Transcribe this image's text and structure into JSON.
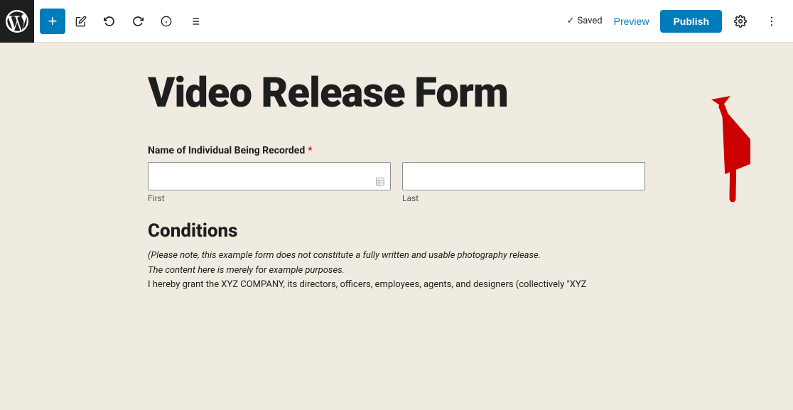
{
  "toolbar": {
    "add_btn_label": "+",
    "saved_label": "Saved",
    "preview_label": "Preview",
    "publish_label": "Publish",
    "icons": {
      "pencil": "✏",
      "undo": "↩",
      "redo": "↪",
      "info": "ⓘ",
      "list": "≡",
      "settings": "⚙",
      "more": "⋮"
    }
  },
  "page": {
    "title": "Video Release Form",
    "form": {
      "name_field_label": "Name of Individual Being Recorded",
      "required_marker": "*",
      "first_sublabel": "First",
      "last_sublabel": "Last",
      "first_placeholder": "",
      "last_placeholder": ""
    },
    "conditions": {
      "title": "Conditions",
      "text_line1": "(Please note, this example form does not constitute a fully written and usable photography release.",
      "text_line2": "The content here is merely for example purposes.",
      "text_line3": "I hereby grant the XYZ COMPANY, its directors, officers, employees, agents, and designers (collectively \"XYZ"
    }
  }
}
